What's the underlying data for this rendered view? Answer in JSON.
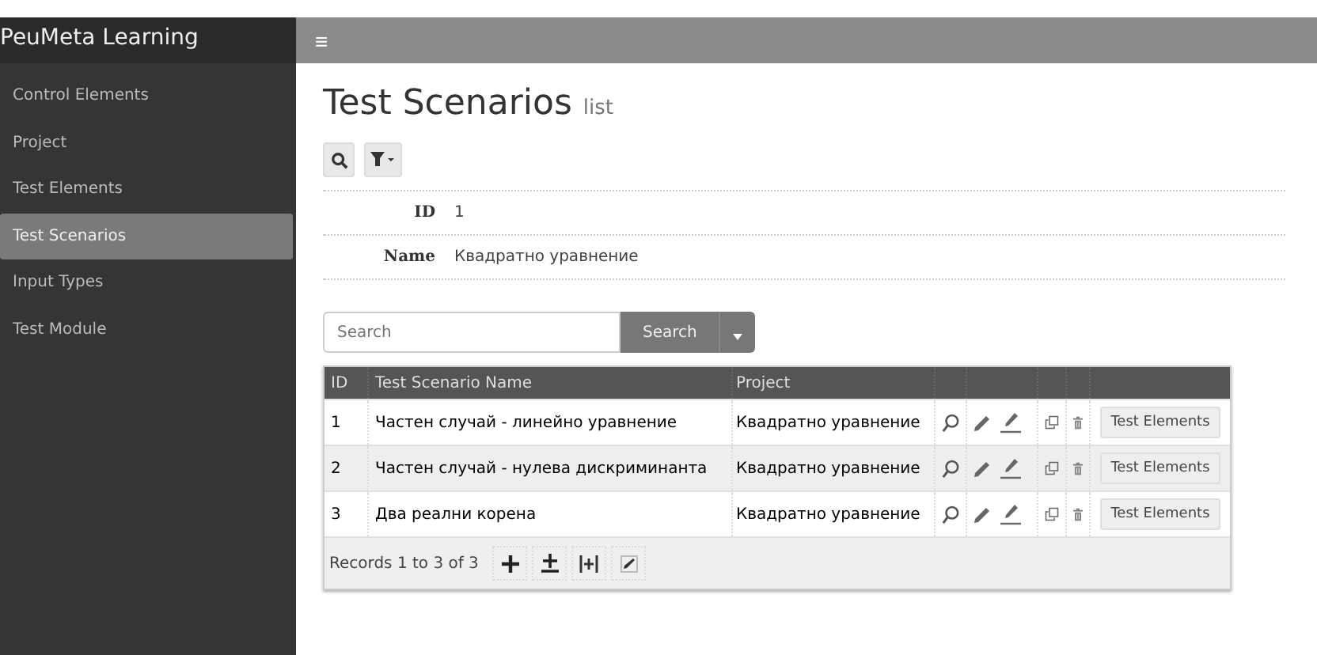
{
  "sidebar": {
    "brand": "PeuMeta Learning",
    "items": [
      {
        "label": "Control Elements",
        "selected": false
      },
      {
        "label": "Project",
        "selected": false
      },
      {
        "label": "Test Elements",
        "selected": false
      },
      {
        "label": "Test Scenarios",
        "selected": true
      },
      {
        "label": "Input Types",
        "selected": false
      },
      {
        "label": "Test Module",
        "selected": false
      }
    ]
  },
  "topbar": {
    "menu_icon": "≡"
  },
  "page": {
    "title": "Test Scenarios",
    "subtitle": "list"
  },
  "filter": [
    {
      "label": "ID",
      "value": "1"
    },
    {
      "label": "Name",
      "value": "Квадратно уравнение"
    }
  ],
  "search": {
    "placeholder": "Search",
    "button": "Search"
  },
  "table": {
    "columns": [
      "ID",
      "Test Scenario Name",
      "Project"
    ],
    "rows": [
      {
        "id": "1",
        "name": "Частен случай - линейно уравнение",
        "project": "Квадратно уравнение",
        "button": "Test Elements"
      },
      {
        "id": "2",
        "name": "Частен случай - нулева дискриминанта",
        "project": "Квадратно уравнение",
        "button": "Test Elements"
      },
      {
        "id": "3",
        "name": "Два реални корена",
        "project": "Квадратно уравнение",
        "button": "Test Elements"
      }
    ],
    "footer": "Records 1 to 3 of 3"
  }
}
